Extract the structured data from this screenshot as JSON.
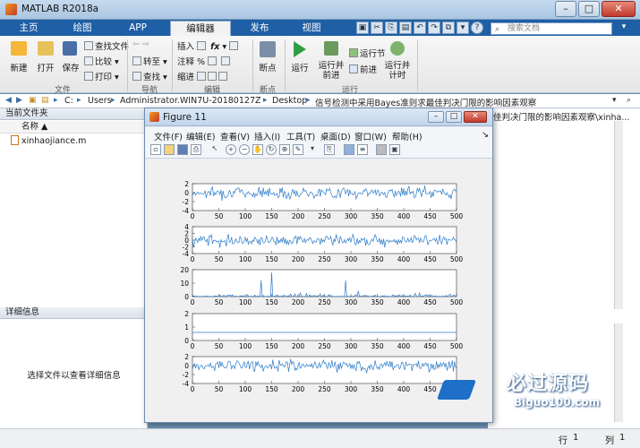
{
  "window": {
    "title": "MATLAB R2018a"
  },
  "tabs": [
    "主页",
    "绘图",
    "APP",
    "编辑器",
    "发布",
    "视图"
  ],
  "active_tab": "编辑器",
  "search": {
    "placeholder": "搜索文档"
  },
  "ribbon": {
    "file": {
      "new": "新建",
      "open": "打开",
      "save": "保存",
      "find_files": "查找文件",
      "compare": "比较",
      "print": "打印",
      "group": "文件"
    },
    "navigate": {
      "goto": "转至",
      "find": "查找",
      "group": "导航"
    },
    "edit": {
      "insert": "插入",
      "comment": "注释",
      "indent": "缩进",
      "group": "编辑"
    },
    "breakpoints": {
      "label": "断点",
      "group": "断点"
    },
    "run": {
      "run": "运行",
      "run_advance": "运行并\n前进",
      "run_section": "运行节",
      "advance": "前进",
      "run_time": "运行并\n计时",
      "group": "运行"
    }
  },
  "address": {
    "crumbs": [
      "C:",
      "Users",
      "Administrator.WIN7U-20180127Z",
      "Desktop",
      "信号检测中采用Bayes准则求最佳判决门限的影响因素观察"
    ]
  },
  "left": {
    "current_folder": "当前文件夹",
    "name_col": "名称",
    "file": "xinhaojiance.m",
    "details_header": "详细信息",
    "details_msg": "选择文件以查看详细信息"
  },
  "right": {
    "header": "佳判决门限的影响因素观察\\xinha..."
  },
  "status": {
    "row_label": "行",
    "row": "1",
    "col_label": "列",
    "col": "1"
  },
  "figure": {
    "title": "Figure 11",
    "menu": [
      "文件(F)",
      "编辑(E)",
      "查看(V)",
      "插入(I)",
      "工具(T)",
      "桌面(D)",
      "窗口(W)",
      "帮助(H)"
    ]
  },
  "chart_data": [
    {
      "type": "line",
      "x_range": [
        0,
        500
      ],
      "ylim": [
        -4,
        2
      ],
      "yticks": [
        2,
        0,
        -2,
        -4
      ],
      "xticks": [
        0,
        50,
        100,
        150,
        200,
        250,
        300,
        350,
        400,
        450,
        500
      ],
      "series": [
        {
          "values": "noisy signal around 0, amplitude approx ±2.5"
        }
      ]
    },
    {
      "type": "line",
      "x_range": [
        0,
        500
      ],
      "ylim": [
        -4,
        4
      ],
      "yticks": [
        4,
        2,
        0,
        -2,
        -4
      ],
      "xticks": [
        0,
        50,
        100,
        150,
        200,
        250,
        300,
        350,
        400,
        450,
        500
      ],
      "series": [
        {
          "values": "noisy signal around 0, amplitude approx ±3"
        }
      ]
    },
    {
      "type": "line",
      "x_range": [
        0,
        500
      ],
      "ylim": [
        0,
        20
      ],
      "yticks": [
        20,
        10,
        0
      ],
      "xticks": [
        0,
        50,
        100,
        150,
        200,
        250,
        300,
        350,
        400,
        450,
        500
      ],
      "series": [
        {
          "values": "squared signal, mostly under 5, spikes to ~18 near x=150"
        }
      ]
    },
    {
      "type": "line",
      "x_range": [
        0,
        500
      ],
      "ylim": [
        0,
        2
      ],
      "yticks": [
        2,
        1,
        0
      ],
      "xticks": [
        0,
        50,
        100,
        150,
        200,
        250,
        300,
        350,
        400,
        450,
        500
      ],
      "series": [
        {
          "values": "constant at approximately 0.6"
        }
      ]
    },
    {
      "type": "line",
      "x_range": [
        0,
        500
      ],
      "ylim": [
        -4,
        2
      ],
      "yticks": [
        2,
        0,
        -2,
        -4
      ],
      "xticks": [
        0,
        50,
        100,
        150,
        200,
        250,
        300,
        350,
        400,
        450,
        500
      ],
      "series": [
        {
          "values": "noisy signal around 0, amplitude approx ±2.5"
        }
      ]
    }
  ],
  "watermark": {
    "brand": "必过源码",
    "url": "Biguo100.com"
  },
  "colors": {
    "ribbon_blue": "#1e5fa6",
    "plot_line": "#2b7bcb"
  }
}
